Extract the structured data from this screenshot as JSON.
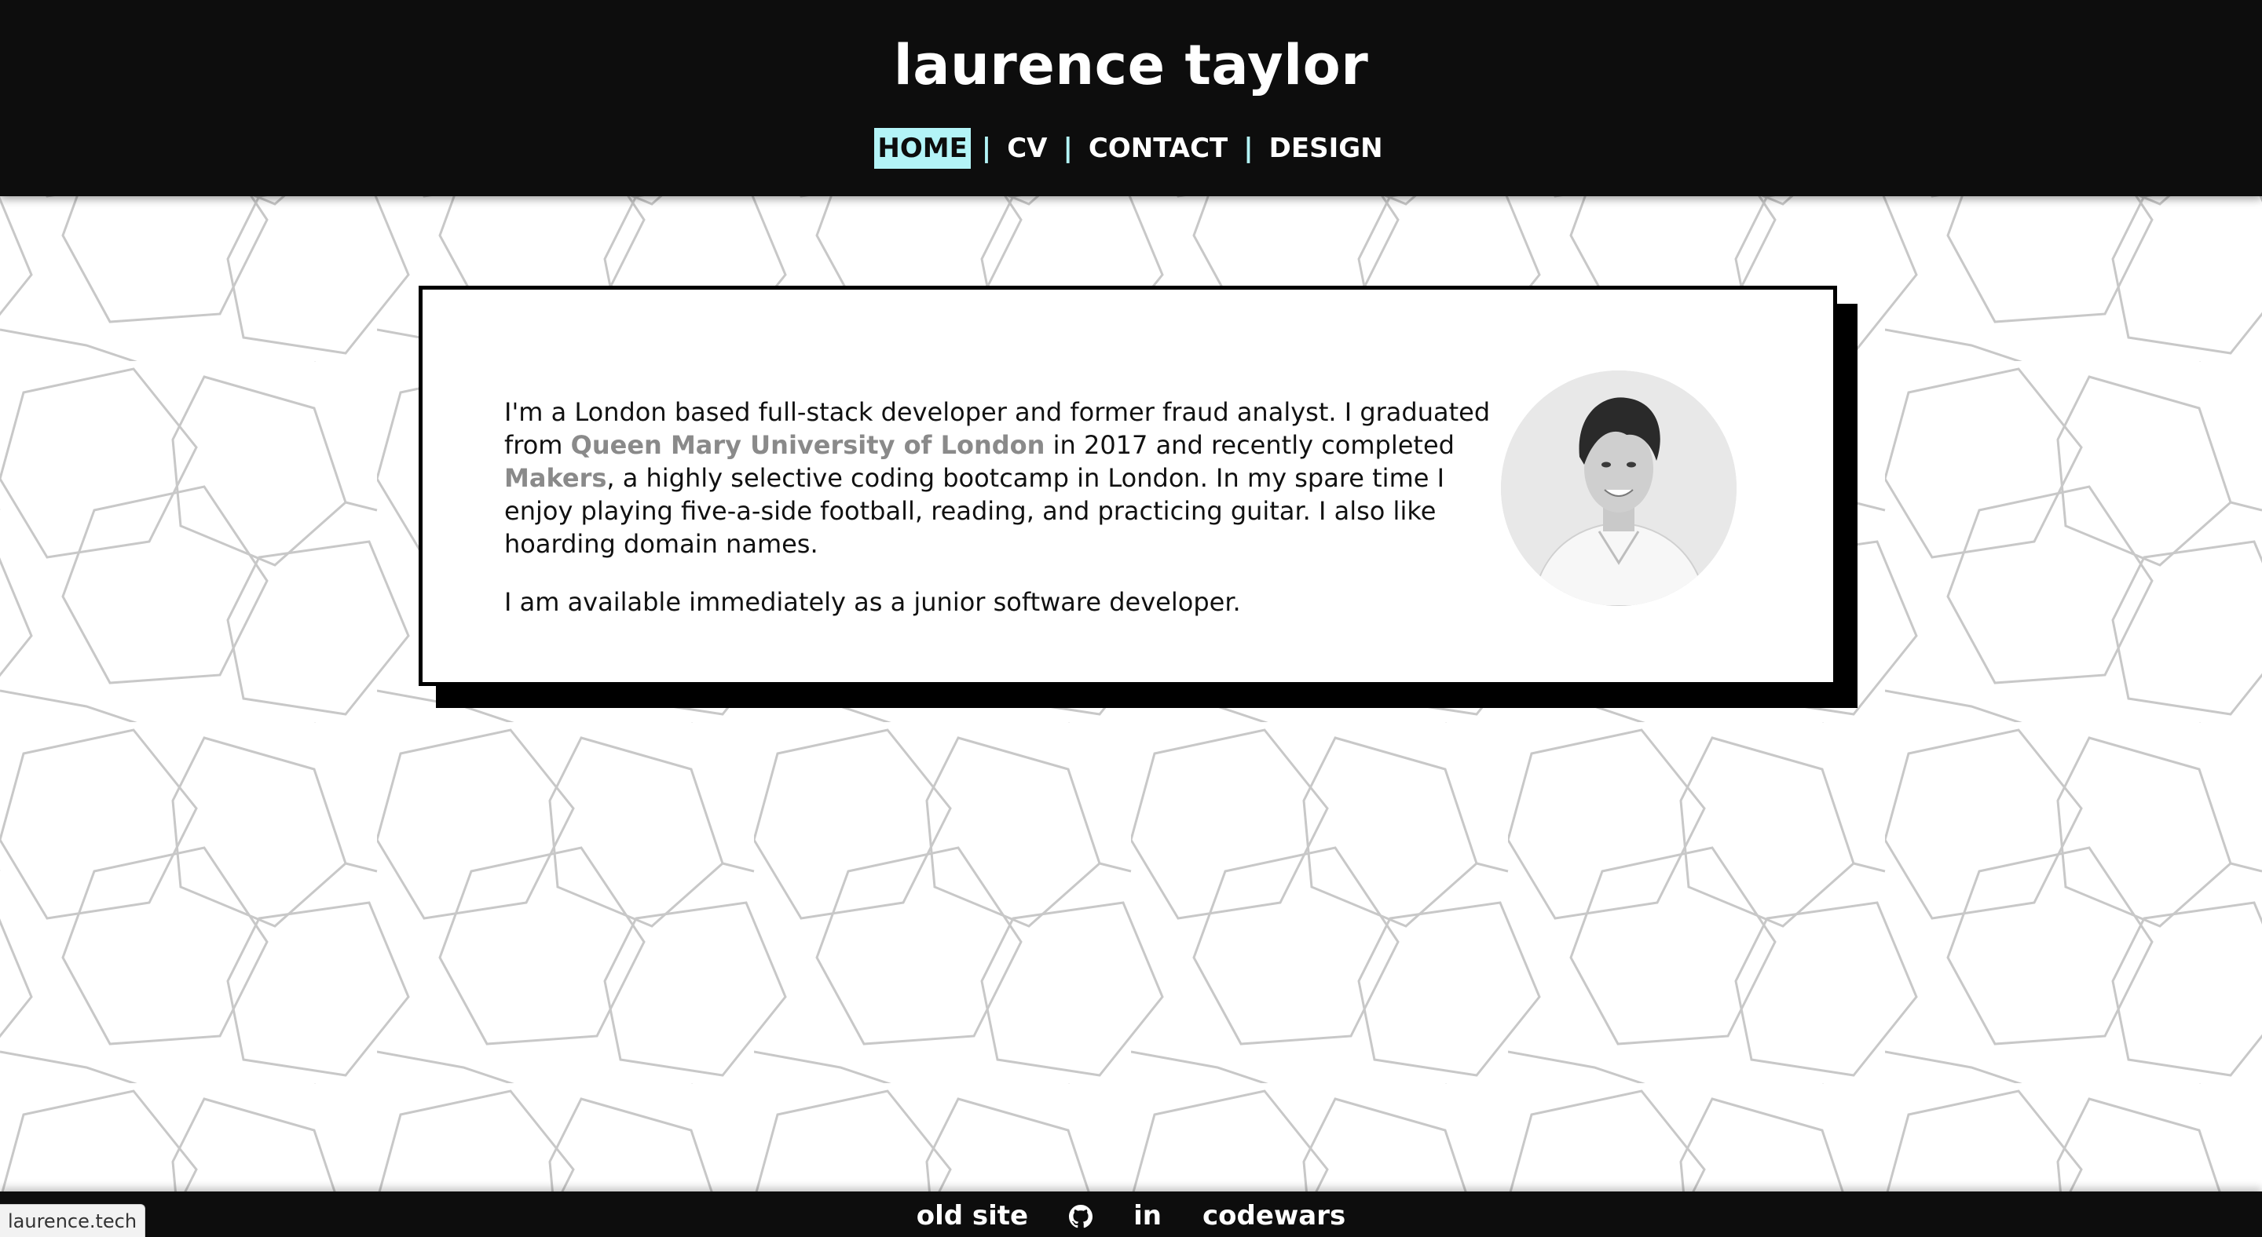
{
  "header": {
    "title": "laurence taylor",
    "nav": [
      {
        "label": "HOME",
        "active": true
      },
      {
        "label": "CV",
        "active": false
      },
      {
        "label": "CONTACT",
        "active": false
      },
      {
        "label": "DESIGN",
        "active": false
      }
    ],
    "separator": "|"
  },
  "about": {
    "p1_a": "I'm a London based full-stack developer and former fraud analyst. I graduated from ",
    "link_university": "Queen Mary University of London",
    "p1_b": " in 2017 and recently completed ",
    "link_makers": "Makers",
    "p1_c": ", a highly selective coding bootcamp in London. In my spare time I enjoy playing five-a-side football, reading, and practicing guitar. I also like hoarding domain names.",
    "p2": "I am available immediately as a junior software developer."
  },
  "footer": {
    "old_site": "old site",
    "github_icon": "github-icon",
    "linkedin": "in",
    "codewars": "codewars"
  },
  "status_bar": {
    "url": "laurence.tech"
  },
  "colors": {
    "header_bg": "#0d0d0d",
    "nav_accent": "#b3f4f7",
    "link_gray": "#8a8a8a",
    "pattern_line": "#c8c8c8"
  }
}
